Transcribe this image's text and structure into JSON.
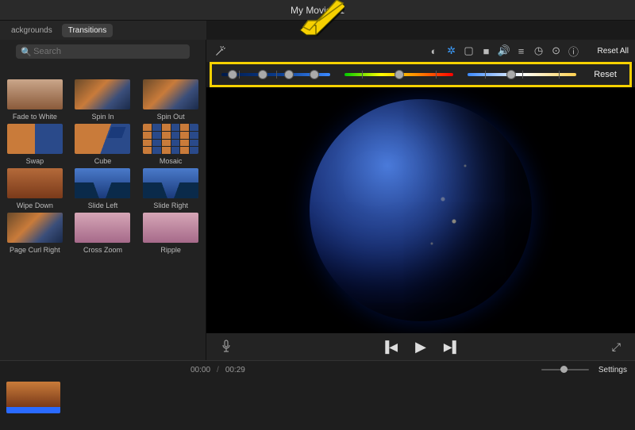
{
  "header": {
    "title": "My Movie 21"
  },
  "browser": {
    "tabs": [
      {
        "label": "ackgrounds",
        "active": false
      },
      {
        "label": "Transitions",
        "active": true
      }
    ],
    "search_placeholder": "Search"
  },
  "transitions": [
    {
      "label": "Fade to White",
      "style": "fade"
    },
    {
      "label": "Spin In",
      "style": ""
    },
    {
      "label": "Spin Out",
      "style": ""
    },
    {
      "label": "Swap",
      "style": "swap"
    },
    {
      "label": "Cube",
      "style": "cube"
    },
    {
      "label": "Mosaic",
      "style": "mosaic"
    },
    {
      "label": "Wipe Down",
      "style": "forest"
    },
    {
      "label": "Slide Left",
      "style": "mountains"
    },
    {
      "label": "Slide Right",
      "style": "mountains"
    },
    {
      "label": "Page Curl Right",
      "style": ""
    },
    {
      "label": "Cross Zoom",
      "style": "pink"
    },
    {
      "label": "Ripple",
      "style": "pink"
    }
  ],
  "toolbar": {
    "reset_all": "Reset All",
    "tools": [
      {
        "name": "color-balance-icon",
        "glyph": "◐",
        "active": false
      },
      {
        "name": "color-correction-icon",
        "glyph": "✲",
        "active": true
      },
      {
        "name": "crop-icon",
        "glyph": "▢",
        "active": false
      },
      {
        "name": "camera-icon",
        "glyph": "■",
        "active": false
      },
      {
        "name": "volume-icon",
        "glyph": "🔊",
        "active": false
      },
      {
        "name": "noise-reduction-icon",
        "glyph": "≡",
        "active": false
      },
      {
        "name": "speed-icon",
        "glyph": "◷",
        "active": false
      },
      {
        "name": "filter-icon",
        "glyph": "⊙",
        "active": false
      },
      {
        "name": "info-icon",
        "glyph": "ⓘ",
        "active": false
      }
    ]
  },
  "color_correction": {
    "reset_label": "Reset",
    "sliders": [
      {
        "name": "shadows-slider",
        "class": "blue",
        "handles": [
          10,
          38,
          62,
          85
        ]
      },
      {
        "name": "saturation-slider",
        "class": "spectrum",
        "handles": [
          50
        ]
      },
      {
        "name": "temperature-slider",
        "class": "temp",
        "handles": [
          40
        ]
      }
    ]
  },
  "timeline": {
    "current": "00:00",
    "total": "00:29",
    "settings_label": "Settings"
  }
}
